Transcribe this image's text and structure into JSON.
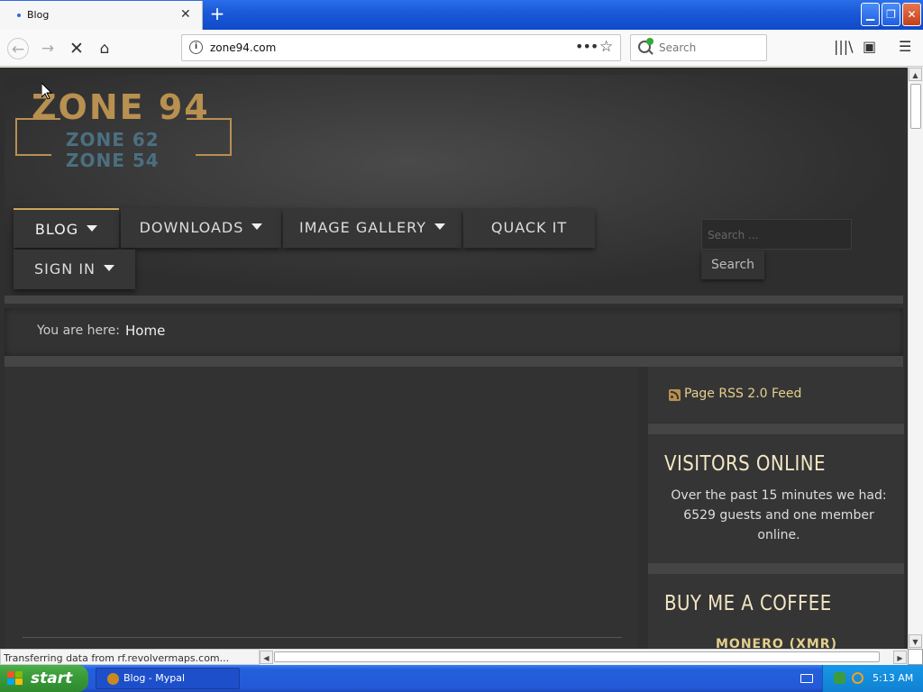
{
  "browser": {
    "tab_title": "Blog",
    "tab_close": "✕",
    "new_tab": "+",
    "url": "zone94.com",
    "url_actions_glyph": "•••",
    "search_placeholder": "Search",
    "status_text": "Transferring data from rf.revolvermaps.com...",
    "minimize_glyph": "▁",
    "restore_glyph": "❐",
    "close_glyph": "✕"
  },
  "site": {
    "logo_main": "ZONE 94",
    "logo_sub1": "ZONE 62",
    "logo_sub2": "ZONE 54",
    "menu": [
      {
        "label": "BLOG",
        "has_caret": true,
        "active": true
      },
      {
        "label": "DOWNLOADS",
        "has_caret": true
      },
      {
        "label": "IMAGE GALLERY",
        "has_caret": true
      },
      {
        "label": "QUACK IT",
        "has_caret": false
      },
      {
        "label": "SIGN IN",
        "has_caret": true
      }
    ],
    "search_placeholder": "Search ...",
    "search_button": "Search",
    "breadcrumb_label": "You are here:",
    "breadcrumb_home": "Home",
    "rss_link": "Page RSS 2.0 Feed",
    "visitors_title": "VISITORS ONLINE",
    "visitors_text": "Over the past 15 minutes we had: 6529 guests and one member online.",
    "coffee_title": "BUY ME A COFFEE",
    "monero_label": "MONERO (XMR)"
  },
  "taskbar": {
    "start": "start",
    "window_item": "Blog - Mypal",
    "clock": "5:13 AM"
  },
  "colors": {
    "accent_gold": "#b89050",
    "logo_blue": "#4c6f80",
    "xp_blue": "#2459d6",
    "start_green": "#3b9b3a"
  }
}
